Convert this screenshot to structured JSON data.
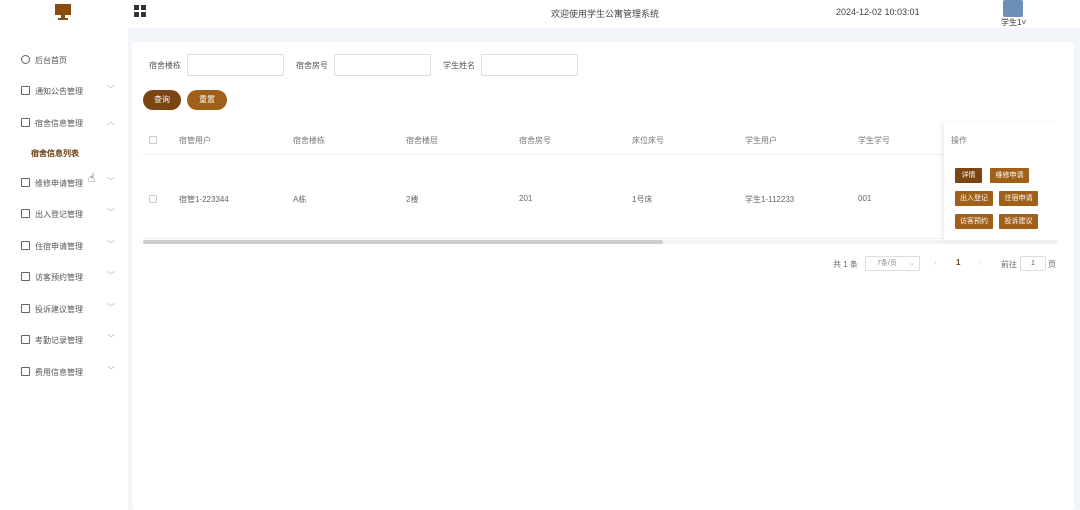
{
  "header": {
    "title": "欢迎使用学生公寓管理系统",
    "datetime": "2024-12-02 10:03:01",
    "user": "学生1"
  },
  "sidebar": {
    "items": [
      {
        "label": "后台首页",
        "icon": "clock-icon",
        "chevron": ""
      },
      {
        "label": "通知公告管理",
        "icon": "doc-icon",
        "chevron": "﹀"
      },
      {
        "label": "宿舍信息管理",
        "icon": "doc-icon",
        "chevron": "︿"
      },
      {
        "label": "宿舍信息列表",
        "sub": true
      },
      {
        "label": "维修申请管理",
        "icon": "doc-icon",
        "chevron": "﹀"
      },
      {
        "label": "出入登记管理",
        "icon": "doc-icon",
        "chevron": "﹀"
      },
      {
        "label": "住宿申请管理",
        "icon": "doc-icon",
        "chevron": "﹀"
      },
      {
        "label": "访客预约管理",
        "icon": "doc-icon",
        "chevron": "﹀"
      },
      {
        "label": "投诉建议管理",
        "icon": "doc-icon",
        "chevron": "﹀"
      },
      {
        "label": "考勤记录管理",
        "icon": "doc-icon",
        "chevron": "﹀"
      },
      {
        "label": "费用信息管理",
        "icon": "doc-icon",
        "chevron": "﹀"
      }
    ]
  },
  "search": {
    "building_label": "宿舍楼栋",
    "room_label": "宿舍房号",
    "student_label": "学生姓名",
    "query_button": "查询",
    "reset_button": "重置"
  },
  "table": {
    "headers": [
      "宿管用户",
      "宿舍楼栋",
      "宿舍楼层",
      "宿舍房号",
      "床位床号",
      "学生用户",
      "学生学号"
    ],
    "ops_header": "操作",
    "rows": [
      {
        "cells": [
          "宿管1-223344",
          "A栋",
          "2楼",
          "201",
          "1号床",
          "学生1-112233",
          "001"
        ]
      }
    ],
    "ops_buttons": [
      "详情",
      "维修申请",
      "出入登记",
      "住宿申请",
      "访客预约",
      "投诉建议"
    ]
  },
  "pagination": {
    "total": "共 1 条",
    "page_size": "7条/页",
    "prev": "‹",
    "current": "1",
    "next": "›",
    "goto": "前往",
    "goto_value": "1",
    "page_suffix": "页"
  }
}
